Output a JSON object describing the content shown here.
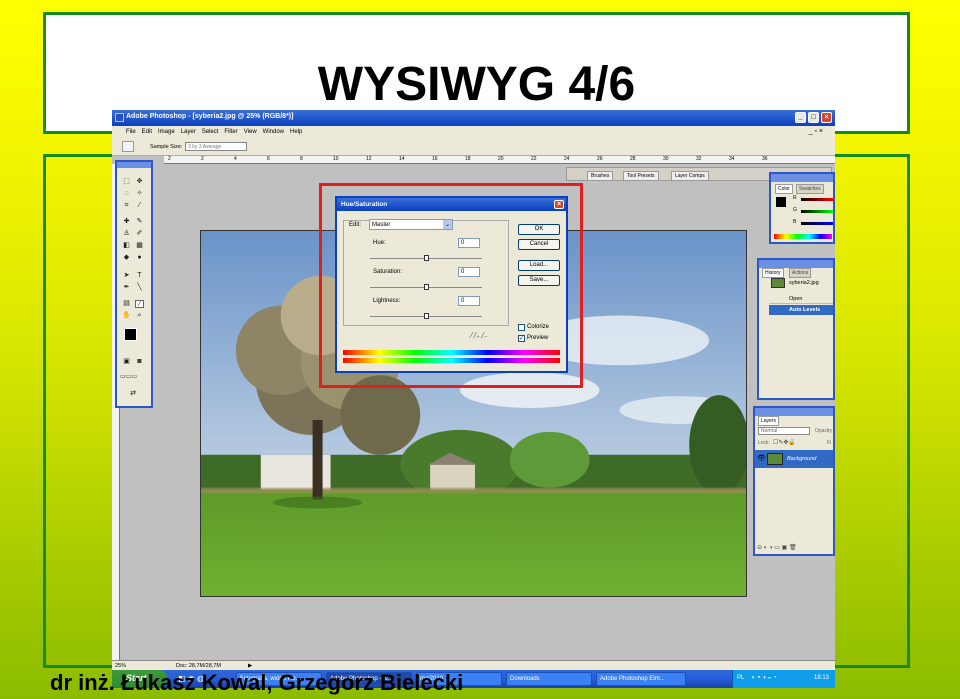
{
  "slide": {
    "title": "WYSIWYG 4/6",
    "footer": "dr inż. Łukasz Kowal, Grzegorz Bielecki"
  },
  "colors": {
    "slide_border": "#138c1a",
    "highlight": "#e0201e",
    "xp_blue": "#0a3fbf"
  },
  "photoshop": {
    "title": "Adobe Photoshop - [syberia2.jpg @ 25% (RGB/8*)]",
    "menu": [
      "File",
      "Edit",
      "Image",
      "Layer",
      "Select",
      "Filter",
      "View",
      "Window",
      "Help"
    ],
    "options": {
      "sample_label": "Sample Size:",
      "sample_value": "3 by 3 Average"
    },
    "palette_well": [
      "Brushes",
      "Tool Presets",
      "Layer Comps"
    ],
    "ruler_ticks": [
      "2",
      "0",
      "2",
      "4",
      "6",
      "8",
      "10",
      "12",
      "14",
      "16",
      "18",
      "20",
      "22",
      "24",
      "26",
      "28",
      "30",
      "32",
      "34",
      "36"
    ],
    "status": {
      "zoom": "25%",
      "doc": "Doc: 28,7M/28,7M"
    },
    "color_panel": {
      "tabs": [
        "Color",
        "Swatches"
      ],
      "channels": [
        "R",
        "G",
        "B"
      ]
    },
    "history_panel": {
      "tabs": [
        "History",
        "Actions"
      ],
      "snapshot": "syberia2.jpg",
      "items": [
        "Open",
        "Auto Levels"
      ]
    },
    "layers_panel": {
      "tab": "Layers",
      "blend_mode": "Normal",
      "opacity_label": "Opacity",
      "lock_label": "Lock:",
      "fill_label": "Fi",
      "layer": "Background"
    },
    "dialog": {
      "title": "Hue/Saturation",
      "edit_label": "Edit:",
      "edit_value": "Master",
      "hue_label": "Hue:",
      "hue_value": "0",
      "saturation_label": "Saturation:",
      "saturation_value": "0",
      "lightness_label": "Lightness:",
      "lightness_value": "0",
      "ok": "OK",
      "cancel": "Cancel",
      "load": "Load...",
      "save": "Save...",
      "colorize": "Colorize",
      "preview": "Preview",
      "colorize_checked": false,
      "preview_checked": true
    }
  },
  "taskbar": {
    "start": "Start",
    "buttons": [
      "Fotografia, wideo i te...",
      "Adobe Photoshop - [s...",
      "maj2010",
      "Downloads",
      "Adobe Photoshop Elm..."
    ],
    "lang": "PL",
    "clock": "18:13"
  }
}
